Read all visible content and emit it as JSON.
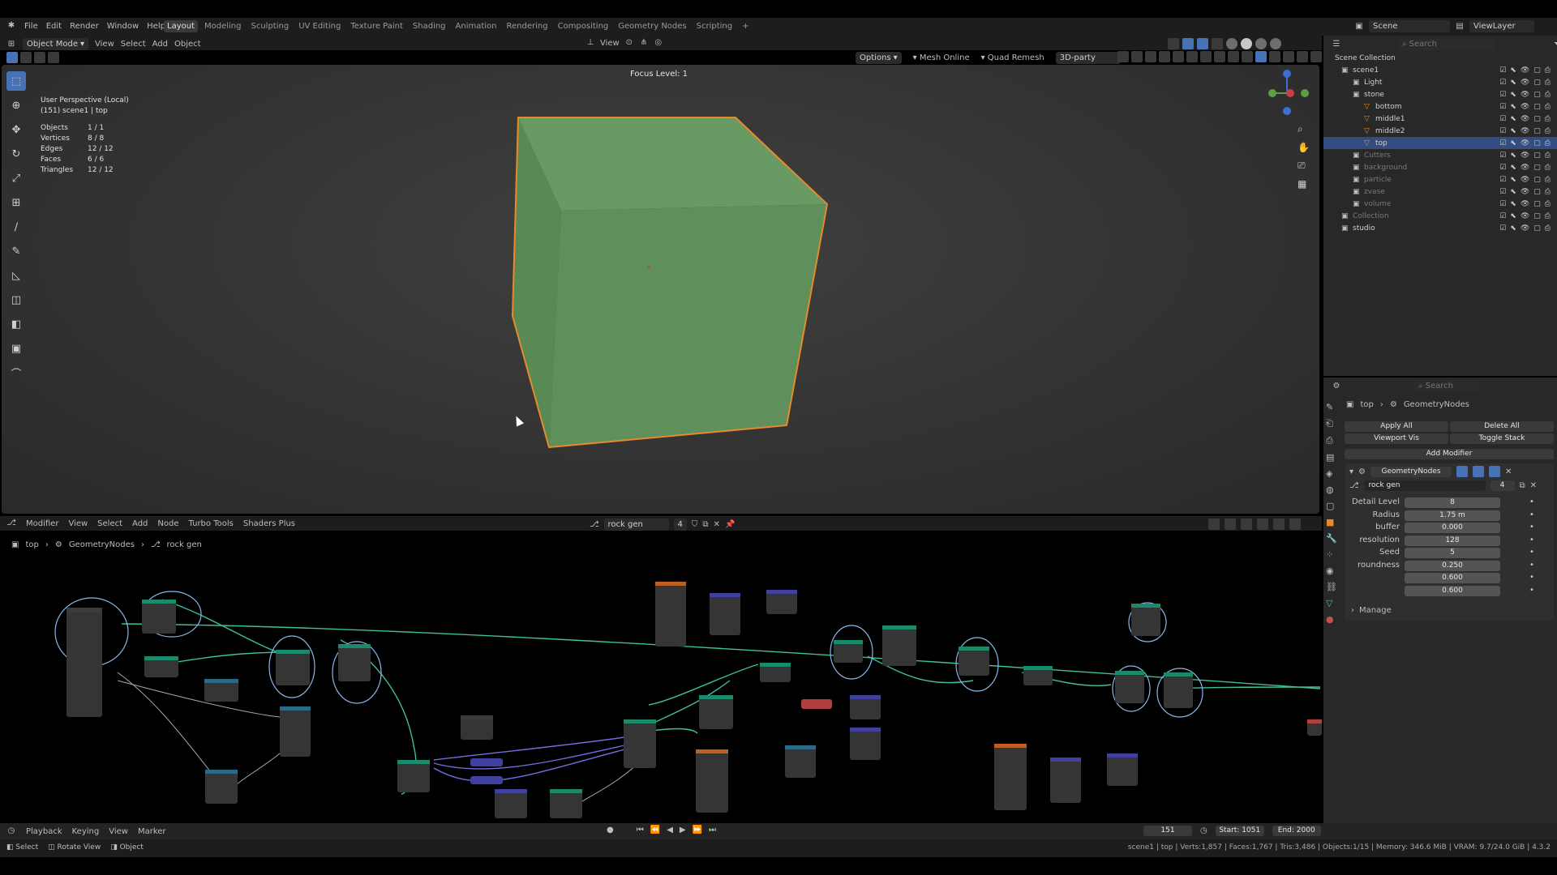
{
  "topbar": {
    "menus": [
      "File",
      "Edit",
      "Render",
      "Window",
      "Help"
    ],
    "workspaces": [
      "Layout",
      "Modeling",
      "Sculpting",
      "UV Editing",
      "Texture Paint",
      "Shading",
      "Animation",
      "Rendering",
      "Compositing",
      "Geometry Nodes",
      "Scripting"
    ],
    "active_workspace": "Layout",
    "scene": "Scene",
    "view_layer": "ViewLayer"
  },
  "viewport_header": {
    "mode": "Object Mode",
    "menus": [
      "View",
      "Select",
      "Add",
      "Object"
    ],
    "transform": "View",
    "options": "Options",
    "mesh_online": "Mesh Online",
    "quad_remesh": "Quad Remesh",
    "addon": "3D-party"
  },
  "viewport": {
    "perspective": "User Perspective (Local)",
    "object_info": "(151) scene1 | top",
    "focus": "Focus Level: 1",
    "stats": [
      {
        "k": "Objects",
        "v": "1 / 1"
      },
      {
        "k": "Vertices",
        "v": "8 / 8"
      },
      {
        "k": "Edges",
        "v": "12 / 12"
      },
      {
        "k": "Faces",
        "v": "6 / 6"
      },
      {
        "k": "Triangles",
        "v": "12 / 12"
      }
    ],
    "cube_color": "#5f8f5a",
    "outline_color": "#e88a2a"
  },
  "outliner": {
    "search_placeholder": "Search",
    "root": "Scene Collection",
    "items": [
      {
        "name": "scene1",
        "depth": 0,
        "state": "normal"
      },
      {
        "name": "Light",
        "depth": 1,
        "state": "normal"
      },
      {
        "name": "stone",
        "depth": 1,
        "state": "normal"
      },
      {
        "name": "bottom",
        "depth": 2,
        "state": "normal"
      },
      {
        "name": "middle1",
        "depth": 2,
        "state": "normal"
      },
      {
        "name": "middle2",
        "depth": 2,
        "state": "normal"
      },
      {
        "name": "top",
        "depth": 2,
        "state": "selected"
      },
      {
        "name": "Cutters",
        "depth": 1,
        "state": "dim"
      },
      {
        "name": "background",
        "depth": 1,
        "state": "dim"
      },
      {
        "name": "particle",
        "depth": 1,
        "state": "dim"
      },
      {
        "name": "zvase",
        "depth": 1,
        "state": "dim"
      },
      {
        "name": "volume",
        "depth": 1,
        "state": "dim"
      },
      {
        "name": "Collection",
        "depth": 0,
        "state": "dim"
      },
      {
        "name": "studio",
        "depth": 0,
        "state": "normal"
      }
    ]
  },
  "properties": {
    "search_placeholder": "Search",
    "breadcrumb": [
      "top",
      "GeometryNodes"
    ],
    "apply_all": "Apply All",
    "delete_all": "Delete All",
    "viewport_vis": "Viewport Vis",
    "toggle_stack": "Toggle Stack",
    "add_modifier": "Add Modifier",
    "modifier_name": "GeometryNodes",
    "node_group": "rock gen",
    "node_group_users": "4",
    "params": [
      {
        "label": "Detail Level",
        "value": "8"
      },
      {
        "label": "Radius",
        "value": "1.75 m"
      },
      {
        "label": "buffer",
        "value": "0.000"
      },
      {
        "label": "resolution",
        "value": "128"
      },
      {
        "label": "Seed",
        "value": "5"
      },
      {
        "label": "roundness",
        "value": "0.250"
      },
      {
        "label": "",
        "value": "0.600"
      },
      {
        "label": "",
        "value": "0.600"
      }
    ],
    "manage": "Manage"
  },
  "node_editor": {
    "type": "Modifier",
    "menus": [
      "View",
      "Select",
      "Add",
      "Node",
      "Turbo Tools",
      "Shaders Plus"
    ],
    "group": "rock gen",
    "users": "4",
    "breadcrumb": [
      "top",
      "GeometryNodes",
      "rock gen"
    ]
  },
  "timeline": {
    "menus": [
      "Playback",
      "Keying",
      "View",
      "Marker"
    ],
    "frame": "151",
    "start": "Start: 1051",
    "end": "End: 2000"
  },
  "statusbar": {
    "left": [
      "Select",
      "Rotate View",
      "Object"
    ],
    "right": "scene1 | top | Verts:1,857 | Faces:1,767 | Tris:3,486 | Objects:1/15 | Memory: 346.6 MiB | VRAM: 9.7/24.0 GiB | 4.3.2"
  }
}
